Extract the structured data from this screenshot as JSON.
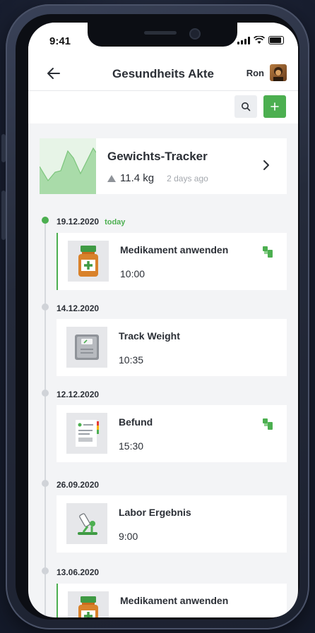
{
  "status": {
    "time": "9:41"
  },
  "header": {
    "title": "Gesundheits Akte",
    "user_name": "Ron"
  },
  "tracker": {
    "title": "Gewichts-Tracker",
    "weight": "11.4 kg",
    "ago": "2 days ago"
  },
  "timeline": {
    "entries": [
      {
        "date": "19.12.2020",
        "today_label": "today",
        "title": "Medikament anwenden",
        "time": "10:00",
        "icon": "medicine-bottle-icon"
      },
      {
        "date": "14.12.2020",
        "title": "Track Weight",
        "time": "10:35",
        "icon": "scale-icon"
      },
      {
        "date": "12.12.2020",
        "title": "Befund",
        "time": "15:30",
        "icon": "document-icon"
      },
      {
        "date": "26.09.2020",
        "title": "Labor Ergebnis",
        "time": "9:00",
        "icon": "microscope-icon"
      },
      {
        "date": "13.06.2020",
        "title": "Medikament anwenden",
        "icon": "medicine-bottle-icon"
      }
    ]
  },
  "colors": {
    "accent": "#4caf50",
    "background": "#f3f4f6",
    "text": "#2b2f36"
  }
}
